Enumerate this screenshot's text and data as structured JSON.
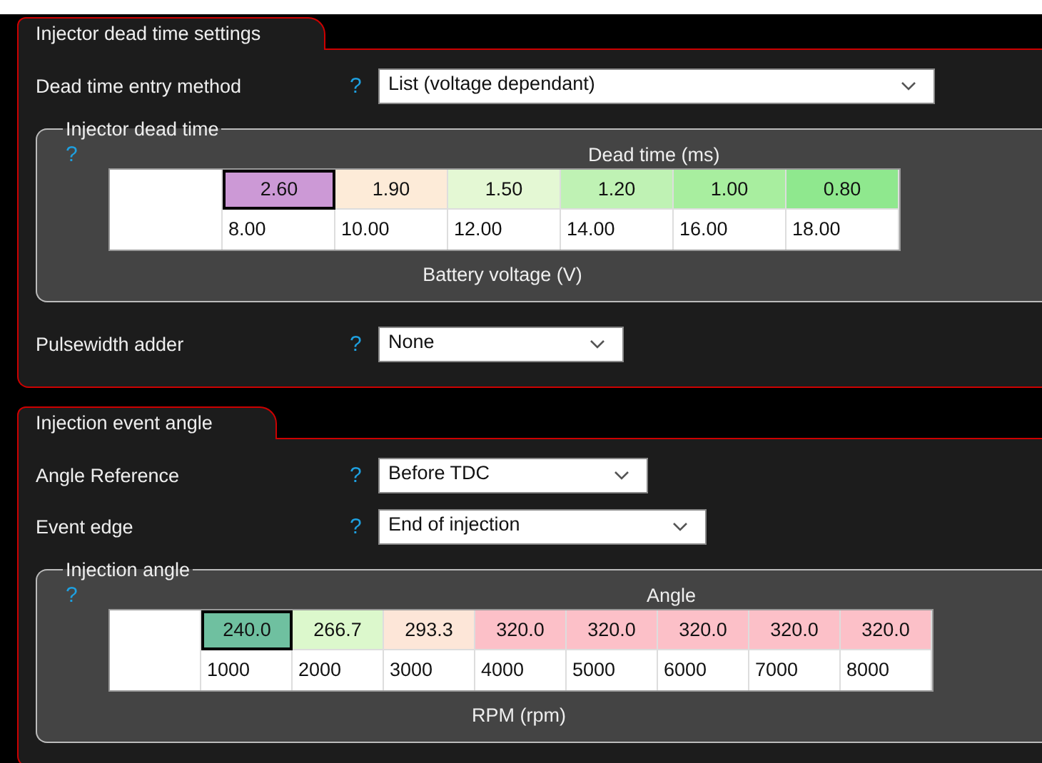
{
  "sections": [
    {
      "tab": "Injector dead time settings",
      "fields_before": [
        {
          "label": "Dead time entry method",
          "help": "?",
          "value": "List (voltage dependant)"
        }
      ],
      "group": {
        "title": "Injector dead time",
        "help": "?",
        "header": "Dead time (ms)",
        "values": [
          {
            "text": "2.60",
            "color": "#cc99d6",
            "selected": true
          },
          {
            "text": "1.90",
            "color": "#fdebd8",
            "selected": false
          },
          {
            "text": "1.50",
            "color": "#e4f8d4",
            "selected": false
          },
          {
            "text": "1.20",
            "color": "#bff2b4",
            "selected": false
          },
          {
            "text": "1.00",
            "color": "#a8ee9f",
            "selected": false
          },
          {
            "text": "0.80",
            "color": "#8fe88e",
            "selected": false
          }
        ],
        "axis": [
          "8.00",
          "10.00",
          "12.00",
          "14.00",
          "16.00",
          "18.00"
        ],
        "axis_label": "Battery voltage (V)"
      },
      "fields_after": [
        {
          "label": "Pulsewidth adder",
          "help": "?",
          "value": "None"
        }
      ]
    },
    {
      "tab": "Injection event angle",
      "fields_before": [
        {
          "label": "Angle Reference",
          "help": "?",
          "value": "Before TDC"
        },
        {
          "label": "Event edge",
          "help": "?",
          "value": "End of injection"
        }
      ],
      "group": {
        "title": "Injection angle",
        "help": "?",
        "header": "Angle",
        "values": [
          {
            "text": "240.0",
            "color": "#6fc0a0",
            "selected": true
          },
          {
            "text": "266.7",
            "color": "#dcf8cc",
            "selected": false
          },
          {
            "text": "293.3",
            "color": "#fde6d8",
            "selected": false
          },
          {
            "text": "320.0",
            "color": "#fcc0c8",
            "selected": false
          },
          {
            "text": "320.0",
            "color": "#fcc0c8",
            "selected": false
          },
          {
            "text": "320.0",
            "color": "#fcc0c8",
            "selected": false
          },
          {
            "text": "320.0",
            "color": "#fcc0c8",
            "selected": false
          },
          {
            "text": "320.0",
            "color": "#fcc0c8",
            "selected": false
          }
        ],
        "axis": [
          "1000",
          "2000",
          "3000",
          "4000",
          "5000",
          "6000",
          "7000",
          "8000"
        ],
        "axis_label": "RPM (rpm)"
      }
    }
  ]
}
